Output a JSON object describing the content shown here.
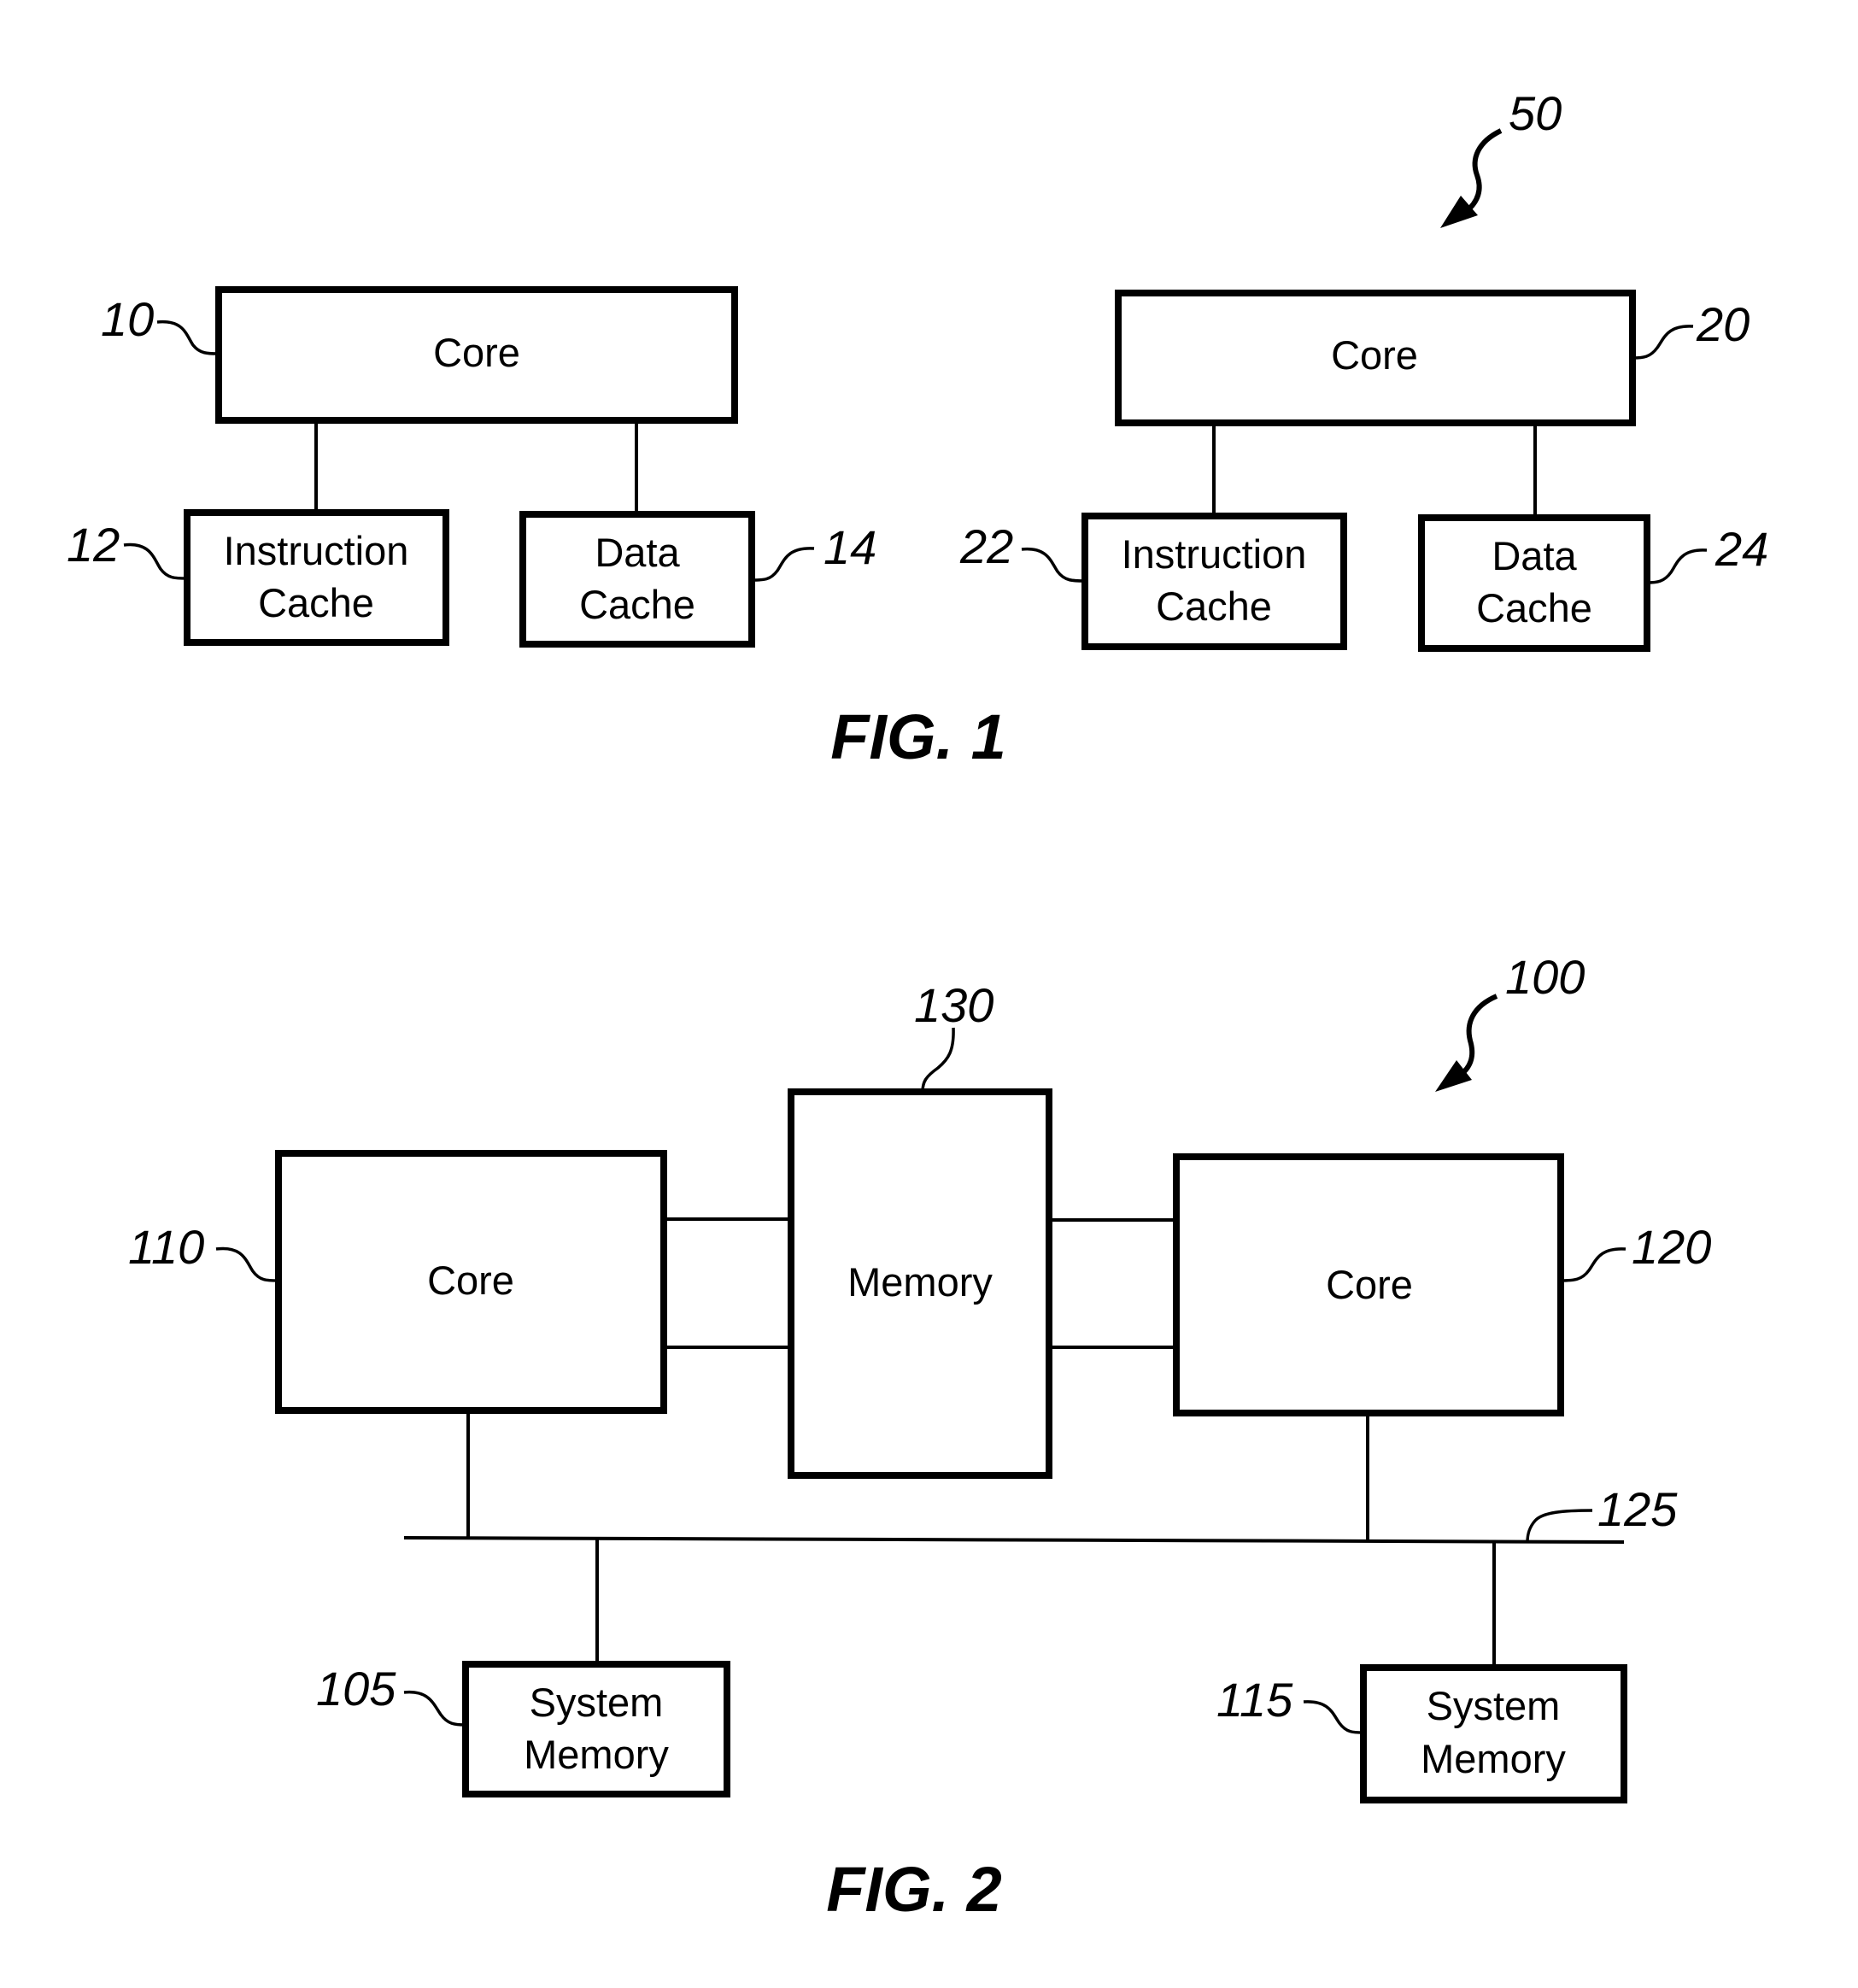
{
  "figure1": {
    "caption": "FIG. 1",
    "systems": [
      {
        "core": {
          "label": "Core",
          "ref": "10"
        },
        "instruction_cache": {
          "line1": "Instruction",
          "line2": "Cache",
          "ref": "12"
        },
        "data_cache": {
          "line1": "Data",
          "line2": "Cache",
          "ref": "14"
        }
      },
      {
        "assembly_ref": "50",
        "core": {
          "label": "Core",
          "ref": "20"
        },
        "instruction_cache": {
          "line1": "Instruction",
          "line2": "Cache",
          "ref": "22"
        },
        "data_cache": {
          "line1": "Data",
          "line2": "Cache",
          "ref": "24"
        }
      }
    ]
  },
  "figure2": {
    "caption": "FIG. 2",
    "assembly_ref": "100",
    "core_left": {
      "label": "Core",
      "ref": "110"
    },
    "memory": {
      "label": "Memory",
      "ref": "130"
    },
    "core_right": {
      "label": "Core",
      "ref": "120"
    },
    "bus": {
      "ref": "125"
    },
    "system_memory_left": {
      "line1": "System",
      "line2": "Memory",
      "ref": "105"
    },
    "system_memory_right": {
      "line1": "System",
      "line2": "Memory",
      "ref": "115"
    }
  }
}
